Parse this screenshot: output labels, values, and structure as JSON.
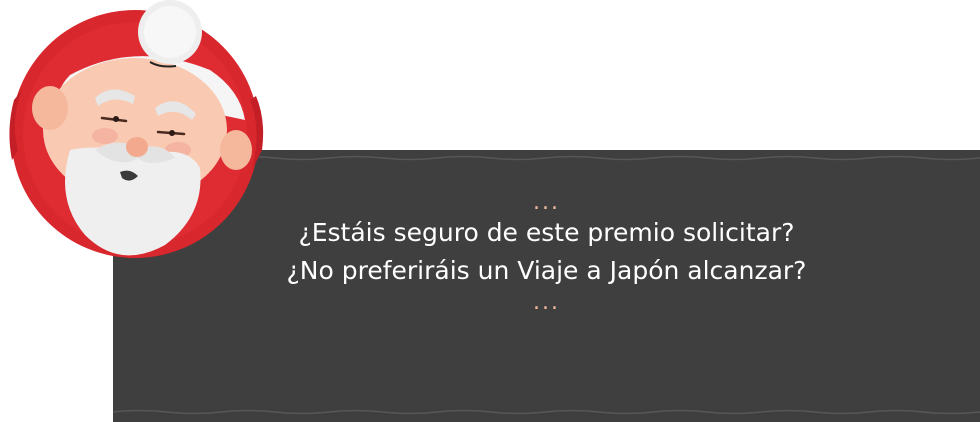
{
  "dialog": {
    "ellipsis_top": "...",
    "line_1": "¿Estáis seguro de este premio solicitar?",
    "line_2": "¿No preferiráis un Viaje a Japón alcanzar?",
    "ellipsis_bottom": "..."
  },
  "colors": {
    "panel_background": "#3f3f3f",
    "text": "#ffffff",
    "ellipsis": "#f2b79d",
    "avatar_ring": "#d9272e"
  },
  "avatar": {
    "icon": "santa-claus-icon"
  }
}
